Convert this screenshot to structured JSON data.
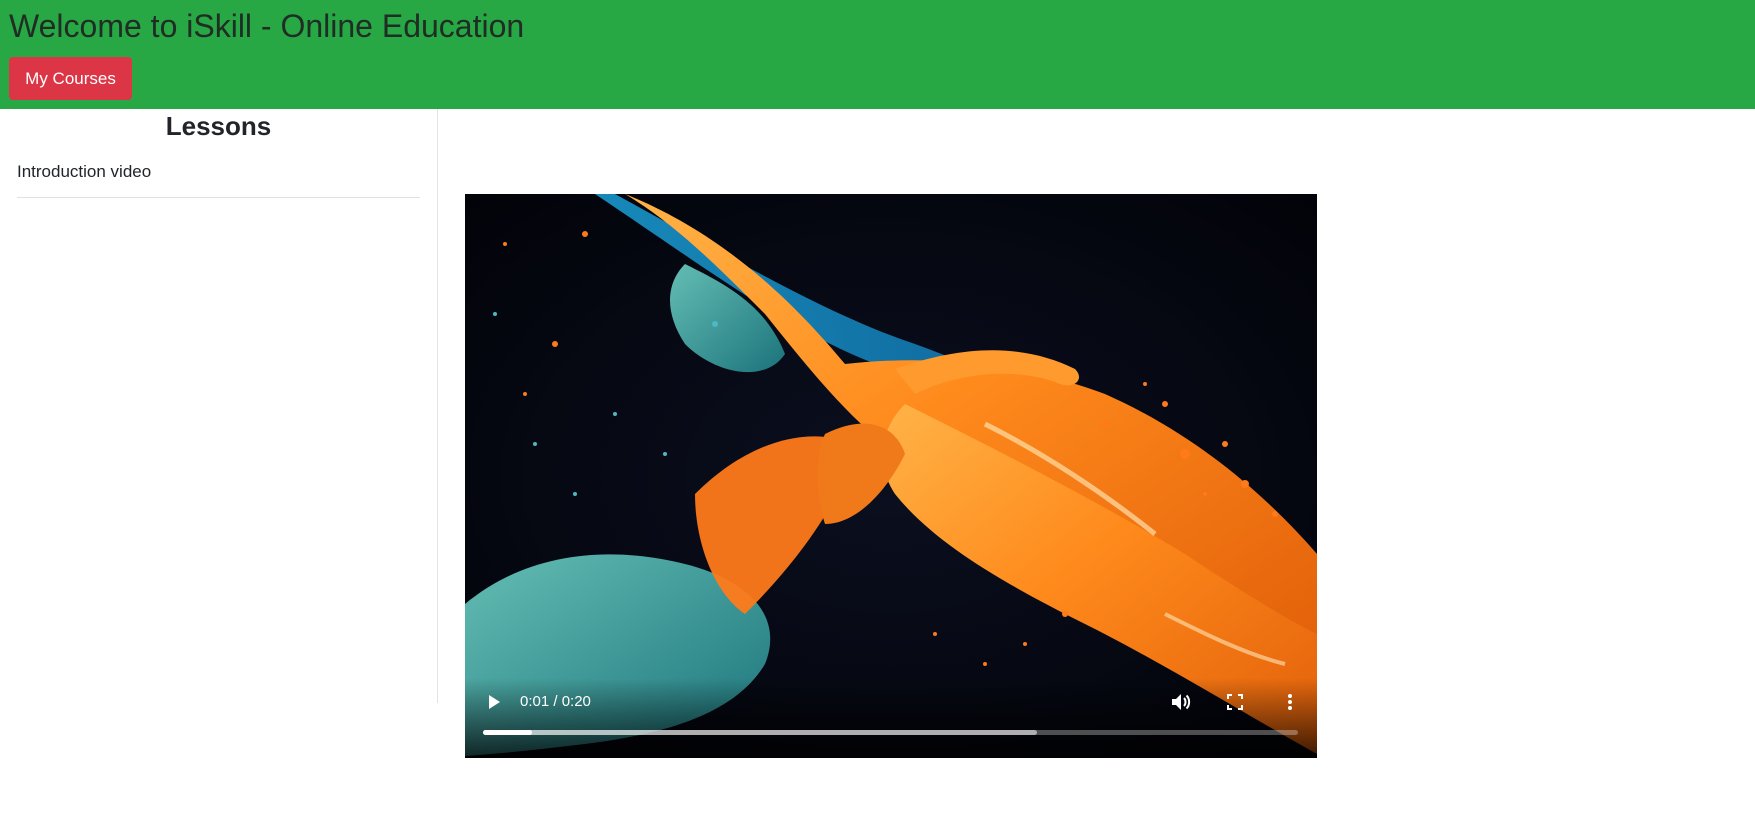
{
  "header": {
    "title": "Welcome to iSkill - Online Education",
    "my_courses_label": "My Courses",
    "bg_color": "#28a745",
    "button_color": "#dc3545"
  },
  "sidebar": {
    "heading": "Lessons",
    "items": [
      {
        "label": "Introduction video"
      }
    ]
  },
  "player": {
    "time": "0:01 / 0:20",
    "played_fraction": 0.06,
    "buffered_fraction": 0.68,
    "icons": [
      "play-icon",
      "volume-icon",
      "fullscreen-icon",
      "more-options-icon"
    ]
  }
}
